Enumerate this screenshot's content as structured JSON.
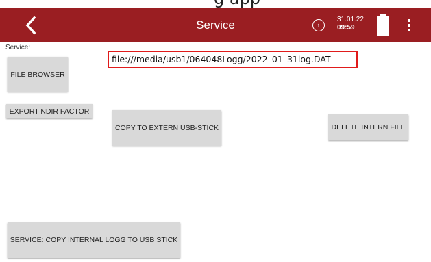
{
  "top_strip": {
    "text": "g  app"
  },
  "appbar": {
    "title": "Service",
    "date": "31.01.22",
    "time": "09:59",
    "background": "#9a1e22",
    "icons": [
      "back-chevron-icon",
      "info-icon",
      "battery-icon",
      "more-vert-icon"
    ]
  },
  "main": {
    "section_label": "Service:",
    "file_path": "file:///media/usb1/064048Logg/2022_01_31log.DAT",
    "buttons": {
      "file_browser": "FILE BROWSER",
      "export_ndir": "EXPORT NDIR FACTOR",
      "copy_extern": "COPY TO EXTERN USB-STICK",
      "delete_intern": "DELETE INTERN FILE",
      "copy_internal_logg": "SERVICE: COPY INTERNAL LOGG TO USB STICK"
    },
    "highlight_color": "#e01b1b"
  }
}
